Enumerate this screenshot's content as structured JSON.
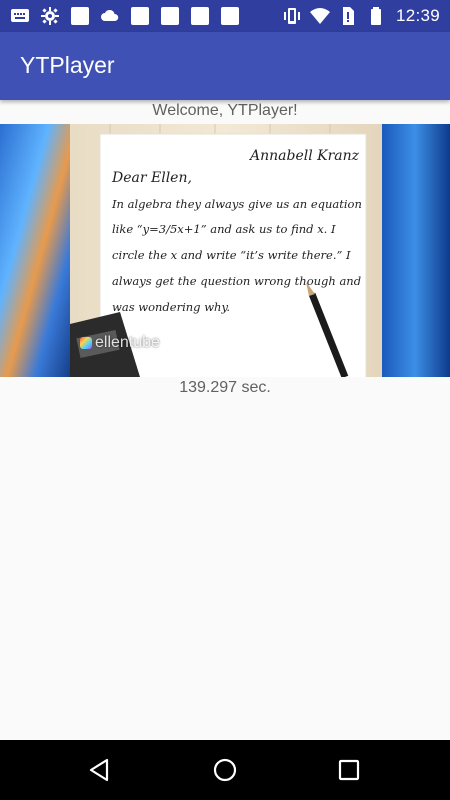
{
  "status_bar": {
    "time": "12:39",
    "left_icons": [
      "message-icon",
      "settings-gear-icon",
      "square-notification-icon",
      "cloud-icon",
      "square-notification-icon",
      "square-notification-icon",
      "square-notification-icon",
      "square-notification-icon"
    ],
    "right_icons": [
      "vibrate-icon",
      "wifi-icon",
      "no-sim-icon",
      "battery-icon"
    ]
  },
  "app_bar": {
    "title": "YTPlayer"
  },
  "main": {
    "welcome_text": "Welcome, YTPlayer!",
    "elapsed_text": "139.297 sec.",
    "video": {
      "letter_signature": "Annabell Kranz",
      "letter_greeting": "Dear Ellen,",
      "letter_lines": [
        "In algebra they always give us an equation",
        "like “y=3/5x+1” and ask us to find x. I",
        "circle the x and write “it’s write there.” I",
        "always get the question wrong though and",
        "was wondering why."
      ],
      "watermark": "ellentube"
    }
  },
  "nav_bar": {
    "buttons": [
      "back-icon",
      "home-icon",
      "recents-icon"
    ]
  }
}
